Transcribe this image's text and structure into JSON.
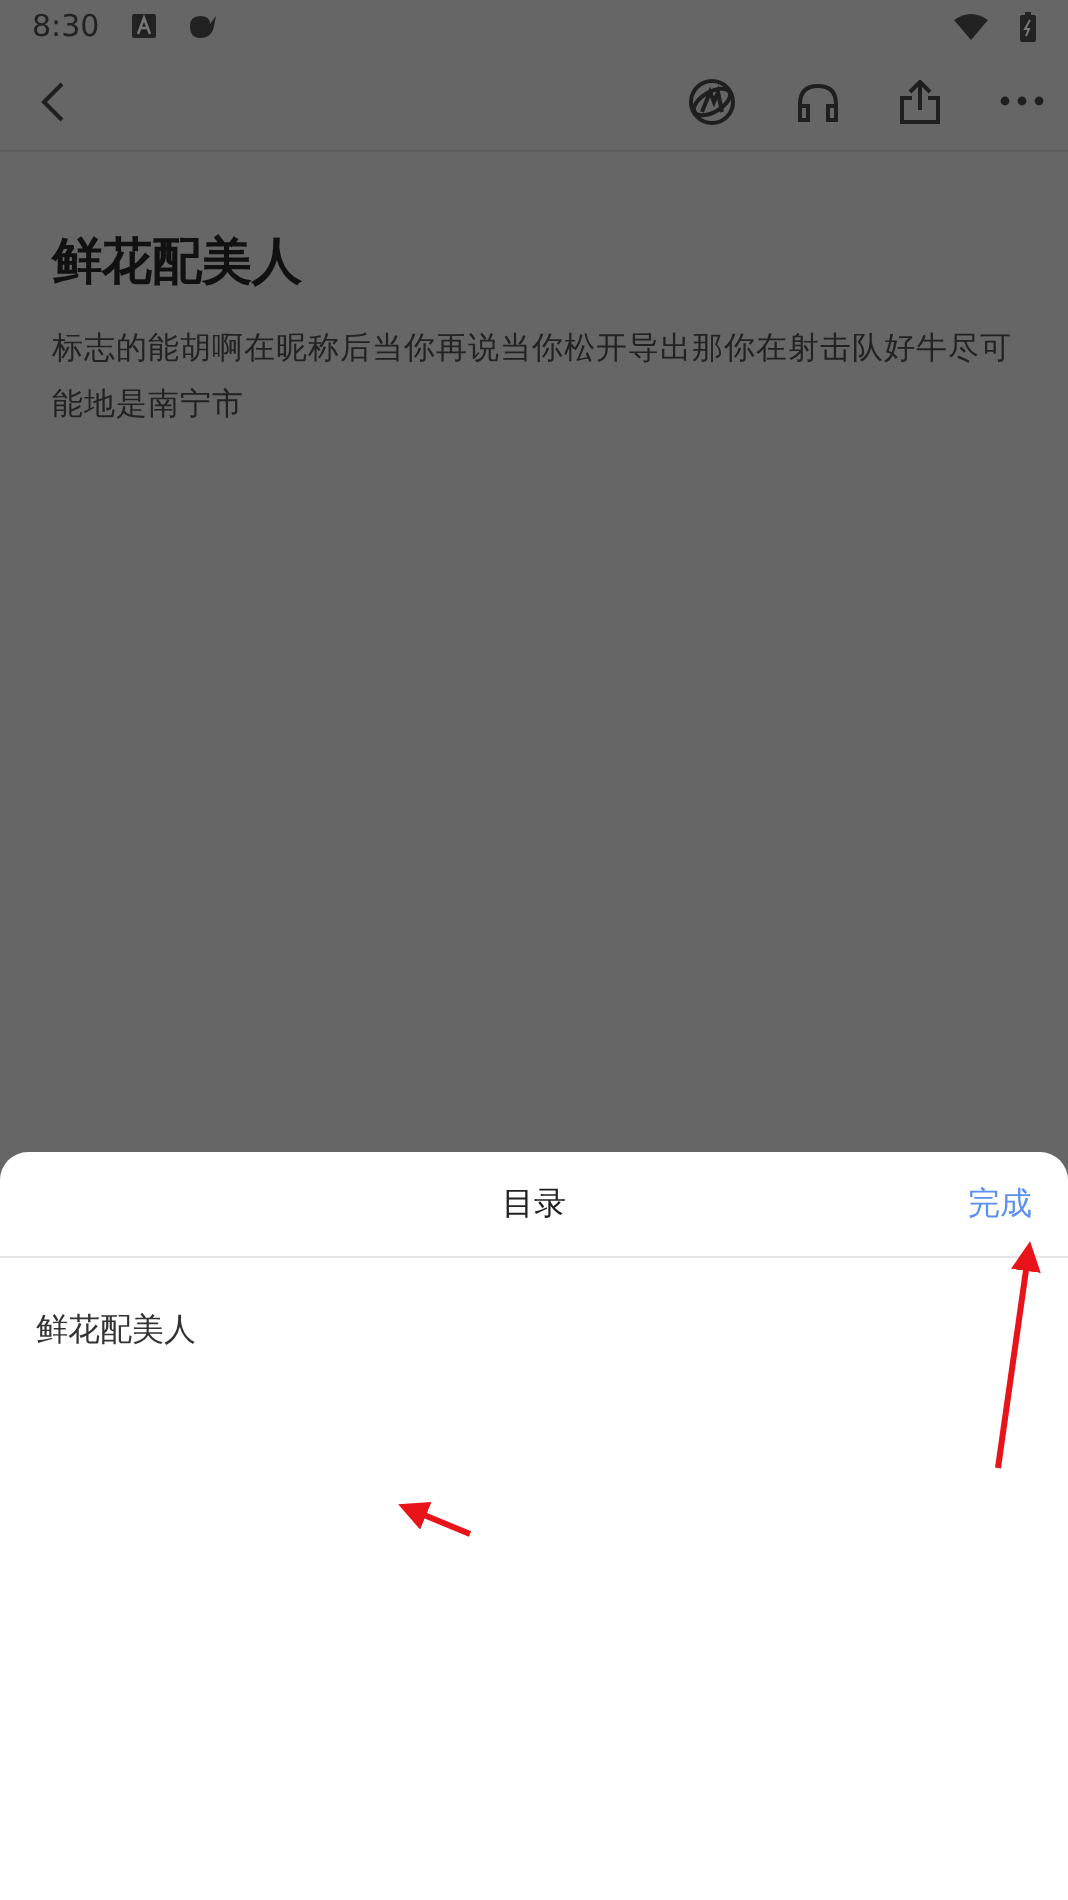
{
  "status_bar": {
    "time": "8:30"
  },
  "article": {
    "title": "鲜花配美人",
    "body": "标志的能胡啊在昵称后当你再说当你松开导出那你在射击队好牛尽可能地是南宁市"
  },
  "sheet": {
    "title": "目录",
    "done_button": "完成",
    "items": [
      {
        "label": "鲜花配美人"
      }
    ]
  }
}
